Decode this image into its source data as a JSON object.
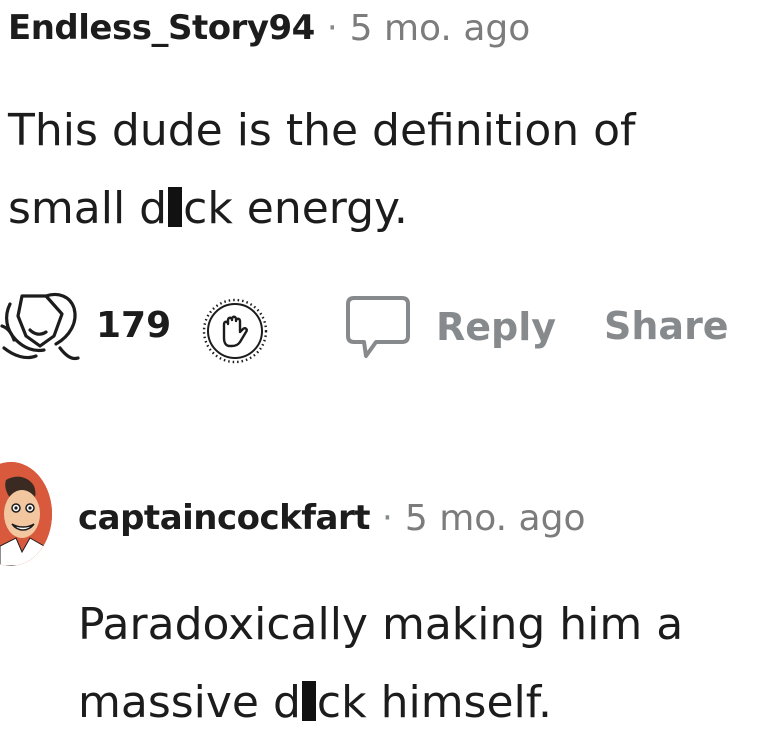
{
  "comment_1": {
    "username": "Endless_Story94",
    "separator": "·",
    "timestamp": "5 mo. ago",
    "body_part1": "This dude is the definition of small d",
    "body_part2": "ck energy.",
    "score": "179",
    "reply_label": "Reply",
    "share_label": "Share",
    "icons": {
      "award": "award-icon",
      "downvote": "downvote-hand-icon",
      "reply": "comment-bubble-icon"
    }
  },
  "comment_2": {
    "username": "captaincockfart",
    "separator": "·",
    "timestamp": "5 mo. ago",
    "body_part1": "Paradoxically making him a massive d",
    "body_part2": "ck himself.",
    "avatar_icon": "user-avatar"
  },
  "colors": {
    "text": "#1c1c1c",
    "muted": "#878a8c",
    "avatar_bg": "#d9593c"
  }
}
